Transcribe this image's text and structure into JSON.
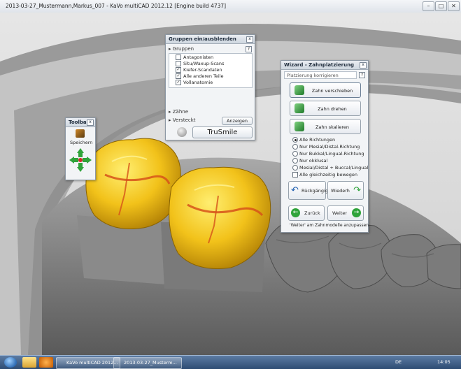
{
  "window": {
    "title": "2013-03-27_Mustermann,Markus_007 - KaVo multiCAD 2012.12 [Engine build 4737]",
    "minimize": "–",
    "maximize": "□",
    "close": "✕"
  },
  "toolbar": {
    "title": "Toolbar",
    "close": "x",
    "save_label": "Speichern"
  },
  "groups": {
    "title": "Gruppen ein/ausblenden",
    "close": "x",
    "groups_header": "Gruppen",
    "help": "?",
    "items": [
      {
        "label": "Antagonisten",
        "checked": ""
      },
      {
        "label": "Situ/Waxup-Scans",
        "checked": ""
      },
      {
        "label": "Kiefer-Scandaten",
        "checked": "✓"
      },
      {
        "label": "Alle anderen Teile",
        "checked": "✓"
      },
      {
        "label": "Vollanatomie",
        "checked": "✓"
      }
    ],
    "teeth_header": "Zähne",
    "hidden_label": "Versteckt",
    "show_button": "Anzeigen",
    "trusmile_button": "TruSmile"
  },
  "wizard": {
    "title": "Wizard - Zahnplatzierung",
    "close": "x",
    "field": "Platzierung korrigieren",
    "help": "?",
    "buttons": [
      {
        "label": "Zahn verschieben"
      },
      {
        "label": "Zahn drehen"
      },
      {
        "label": "Zahn skalieren"
      }
    ],
    "options": [
      {
        "label": "Alle Richtungen",
        "selected": true
      },
      {
        "label": "Nur Mesial/Distal-Richtung",
        "selected": false
      },
      {
        "label": "Nur Bukkal/Lingual-Richtung",
        "selected": false
      },
      {
        "label": "Nur okklusal",
        "selected": false
      },
      {
        "label": "Mesial/Distal + Buccal/Lingual",
        "selected": false
      }
    ],
    "move_all": "Alle gleichzeitig bewegen",
    "undo": "Rückgängig",
    "redo": "Wiederh",
    "back": "Zurück",
    "next": "Weiter",
    "hint": "'Weiter' am Zahnmodelle anzupassen"
  },
  "taskbar": {
    "item1": "KaVo multiCAD 2012...",
    "item2": "2013-03-27_Musterm...",
    "lang": "DE",
    "clock": "14:05"
  }
}
